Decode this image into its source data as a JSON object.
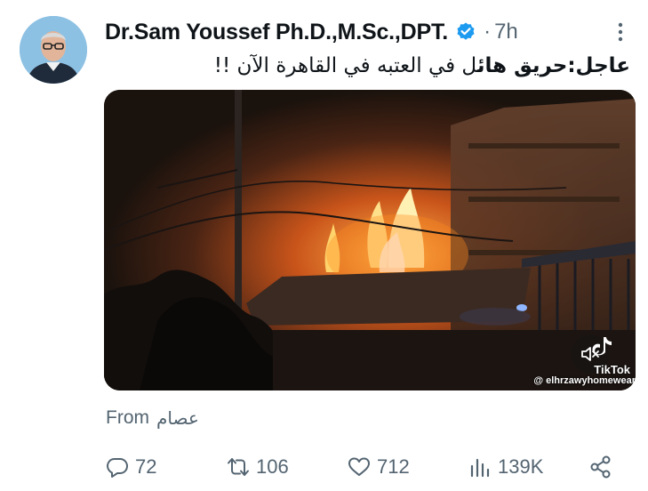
{
  "tweet": {
    "author_name": "Dr.Sam Youssef Ph.D.,M.Sc.,DPT.",
    "separator": "·",
    "time": "7h",
    "text_bold": "عاجل:حريق هائ",
    "text_rest": "ل في العتبه في القاهرة الآن !!",
    "media": {
      "watermark": "TikTok",
      "watermark_user": "@ elhrzawyhomewear"
    },
    "from_label": "From",
    "from_source": "عصام",
    "stats": {
      "replies": "72",
      "reposts": "106",
      "likes": "712",
      "views": "139K"
    }
  },
  "colors": {
    "verified": "#1d9bf0",
    "muted": "#536471",
    "text": "#0f1419",
    "fire": "#ff8a1c"
  },
  "icons": [
    "verified-badge-icon",
    "more-icon",
    "mute-icon",
    "tiktok-logo-icon",
    "reply-icon",
    "repost-icon",
    "like-icon",
    "views-icon",
    "share-icon"
  ]
}
